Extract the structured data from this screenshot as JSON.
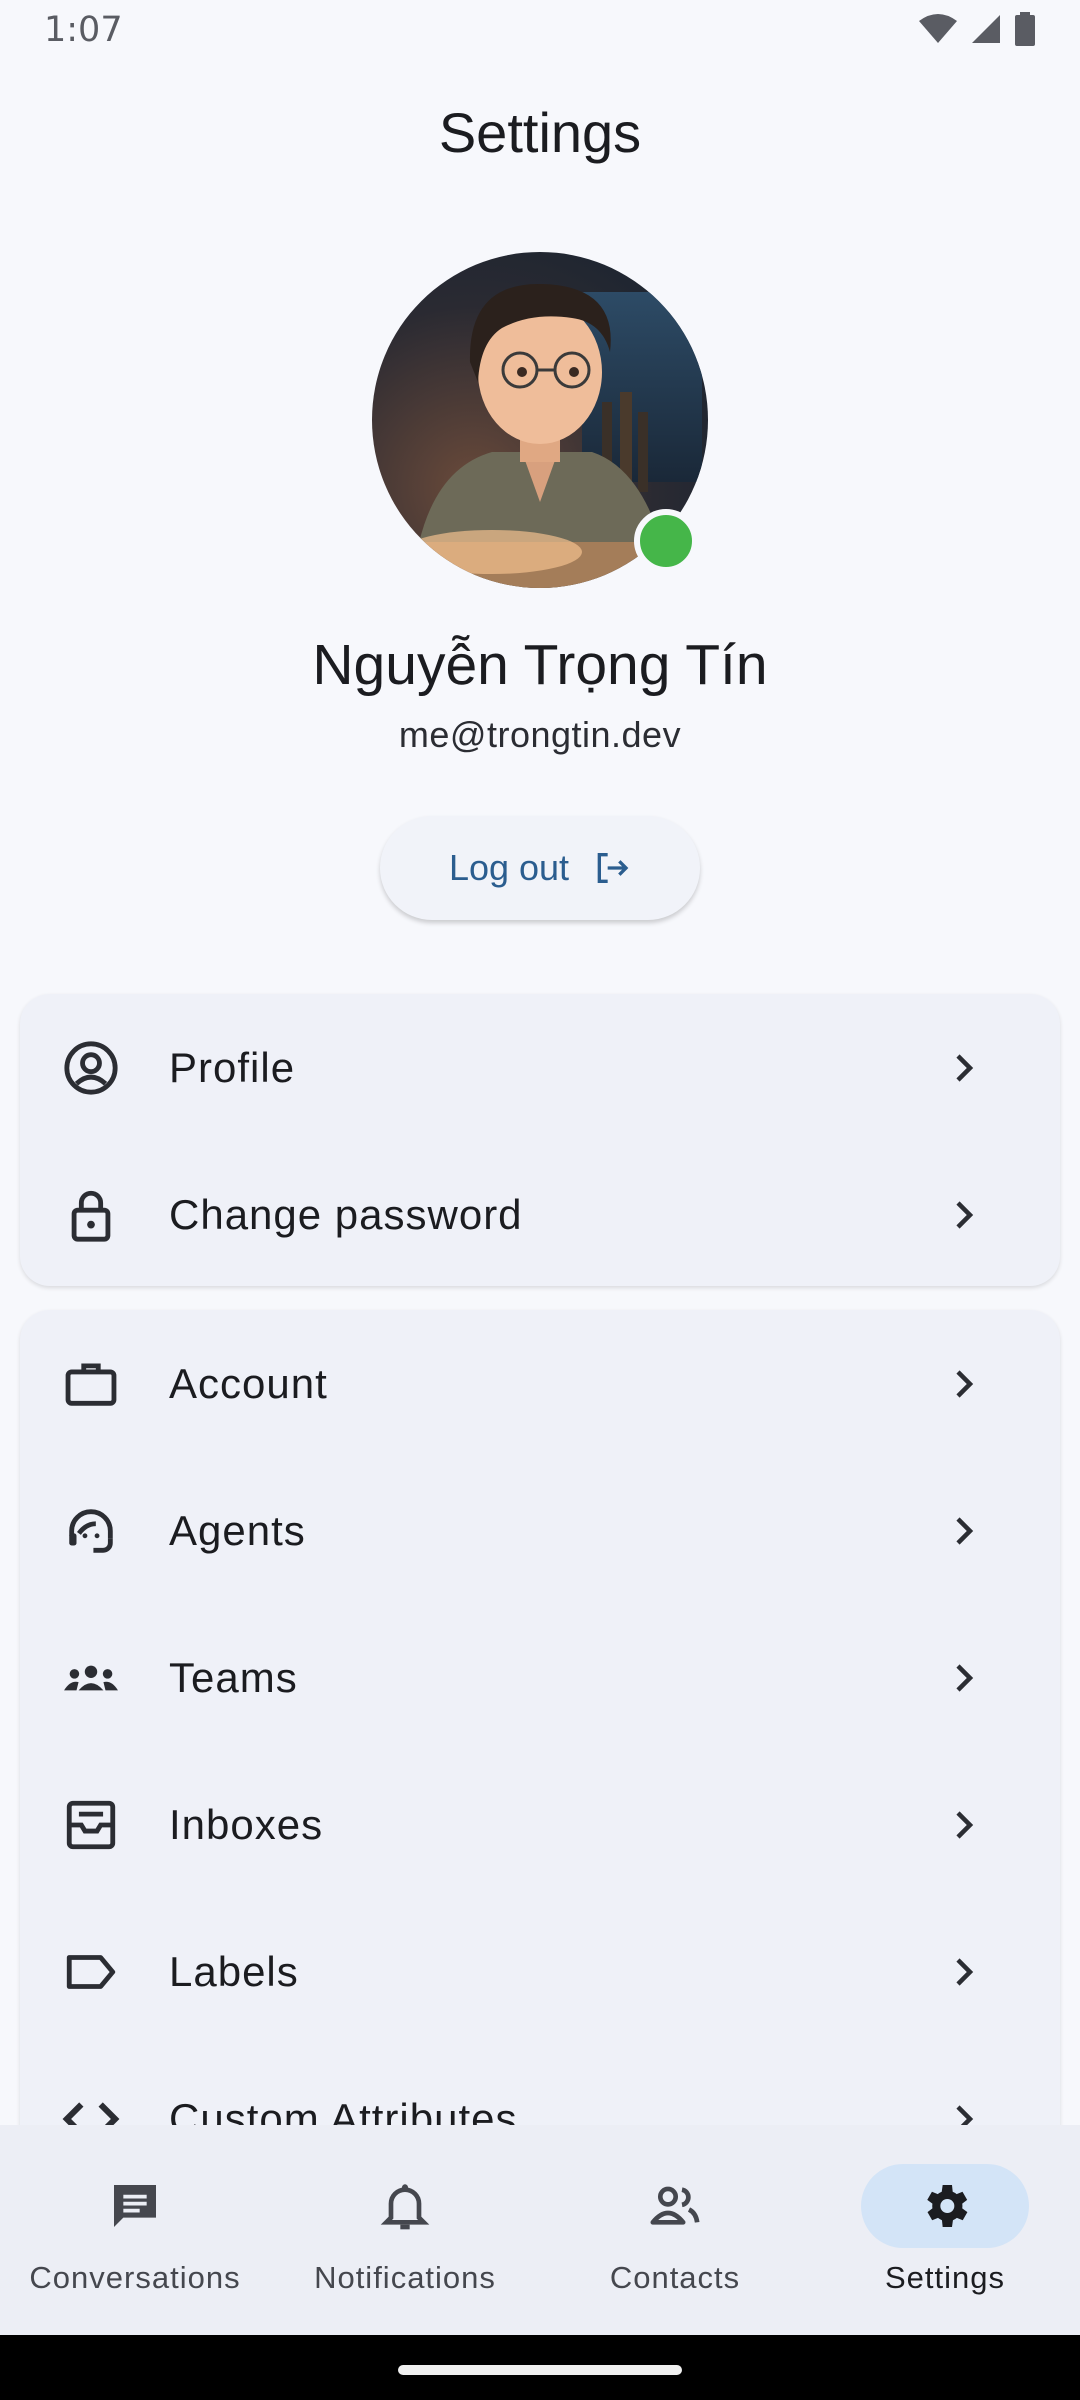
{
  "status_bar": {
    "time": "1:07",
    "icons": [
      "wifi-icon",
      "signal-icon",
      "battery-icon"
    ]
  },
  "page": {
    "title": "Settings"
  },
  "profile": {
    "name": "Nguyễn Trọng Tín",
    "email": "me@trongtin.dev",
    "online_status_color": "#45b649",
    "logout_label": "Log out"
  },
  "menu_groups": [
    {
      "items": [
        {
          "label": "Profile",
          "icon": "account-circle-icon"
        },
        {
          "label": "Change password",
          "icon": "lock-icon"
        }
      ]
    },
    {
      "items": [
        {
          "label": "Account",
          "icon": "briefcase-icon"
        },
        {
          "label": "Agents",
          "icon": "support-agent-icon"
        },
        {
          "label": "Teams",
          "icon": "groups-icon"
        },
        {
          "label": "Inboxes",
          "icon": "inbox-icon"
        },
        {
          "label": "Labels",
          "icon": "label-icon"
        },
        {
          "label": "Custom Attributes",
          "icon": "code-icon"
        }
      ]
    }
  ],
  "bottom_nav": {
    "active": "Settings",
    "items": [
      {
        "label": "Conversations",
        "icon": "chat-icon"
      },
      {
        "label": "Notifications",
        "icon": "bell-icon"
      },
      {
        "label": "Contacts",
        "icon": "people-icon"
      },
      {
        "label": "Settings",
        "icon": "gear-icon"
      }
    ]
  },
  "colors": {
    "accent": "#2b5d8f",
    "active_pill": "#d3e4f7",
    "background": "#f7f8fc",
    "card": "#eff1f8"
  }
}
